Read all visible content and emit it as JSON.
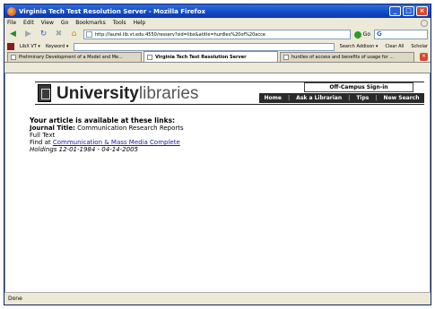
{
  "window": {
    "title": "Virginia Tech Test Resolution Server - Mozilla Firefox",
    "buttons": [
      "_",
      "□",
      "×"
    ]
  },
  "menubar": [
    "File",
    "Edit",
    "View",
    "Go",
    "Bookmarks",
    "Tools",
    "Help"
  ],
  "navbar": {
    "url": "http://laurel.lib.vt.edu:4550/resserv?sid=libx&atitle=hurdles%20of%20acce",
    "go_label": "Go",
    "search_value": "G"
  },
  "toolbar2": {
    "vt_label": "LibX VT ▾",
    "keyword_label": "Keyword ▾",
    "search_addon": "Search Addison ▾",
    "clear_all": "Clear All",
    "scholar": "Scholar"
  },
  "tabs": [
    {
      "label": "Preliminary Development of a Model and Me...",
      "active": false
    },
    {
      "label": "Virginia Tech Test Resolution Server",
      "active": true
    },
    {
      "label": "hurdles of access and benefits of usage for ...",
      "active": false
    }
  ],
  "page": {
    "logo_bold": "University",
    "logo_light": "libraries",
    "offcampus": "Off-Campus Sign-in",
    "nav": [
      "Home",
      "Ask a Librarian",
      "Tips",
      "New Search"
    ],
    "avail_heading": "Your article is available at these links:",
    "journal_label": "Journal Title:",
    "journal_title": "Communication Research Reports",
    "full_text": "Full Text",
    "find_at_prefix": "Find at",
    "find_at_link": "Communication & Mass Media Complete",
    "holdings_label": "Holdings",
    "holdings_range": "12-01-1984 - 04-14-2005"
  },
  "status": "Done"
}
